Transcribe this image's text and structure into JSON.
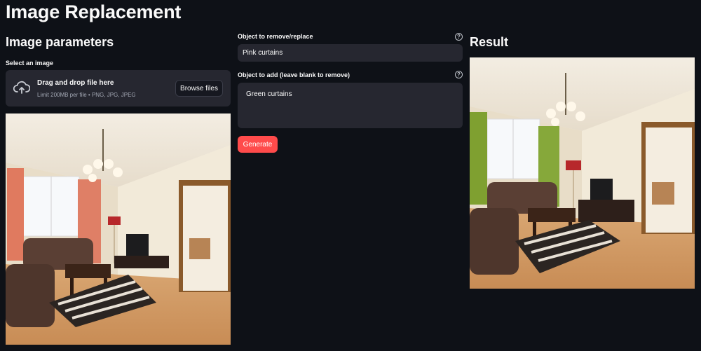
{
  "app": {
    "title": "Image Replacement"
  },
  "left": {
    "section_title": "Image parameters",
    "select_label": "Select an image",
    "uploader": {
      "icon": "cloud-upload-icon",
      "main_text": "Drag and drop file here",
      "sub_text": "Limit 200MB per file • PNG, JPG, JPEG",
      "browse_label": "Browse files"
    },
    "image_alt": "Living room with pink curtains"
  },
  "middle": {
    "remove_label": "Object to remove/replace",
    "remove_value": "Pink curtains",
    "add_label": "Object to add (leave blank to remove)",
    "add_value": "Green curtains",
    "help_icon": "?",
    "generate_label": "Generate"
  },
  "right": {
    "section_title": "Result",
    "image_alt": "Living room with green curtains"
  },
  "colors": {
    "background": "#0e1117",
    "widget": "#262730",
    "primary": "#ff4b4b",
    "original_curtains": "#e07a5f",
    "result_curtains": "#7fa030"
  }
}
